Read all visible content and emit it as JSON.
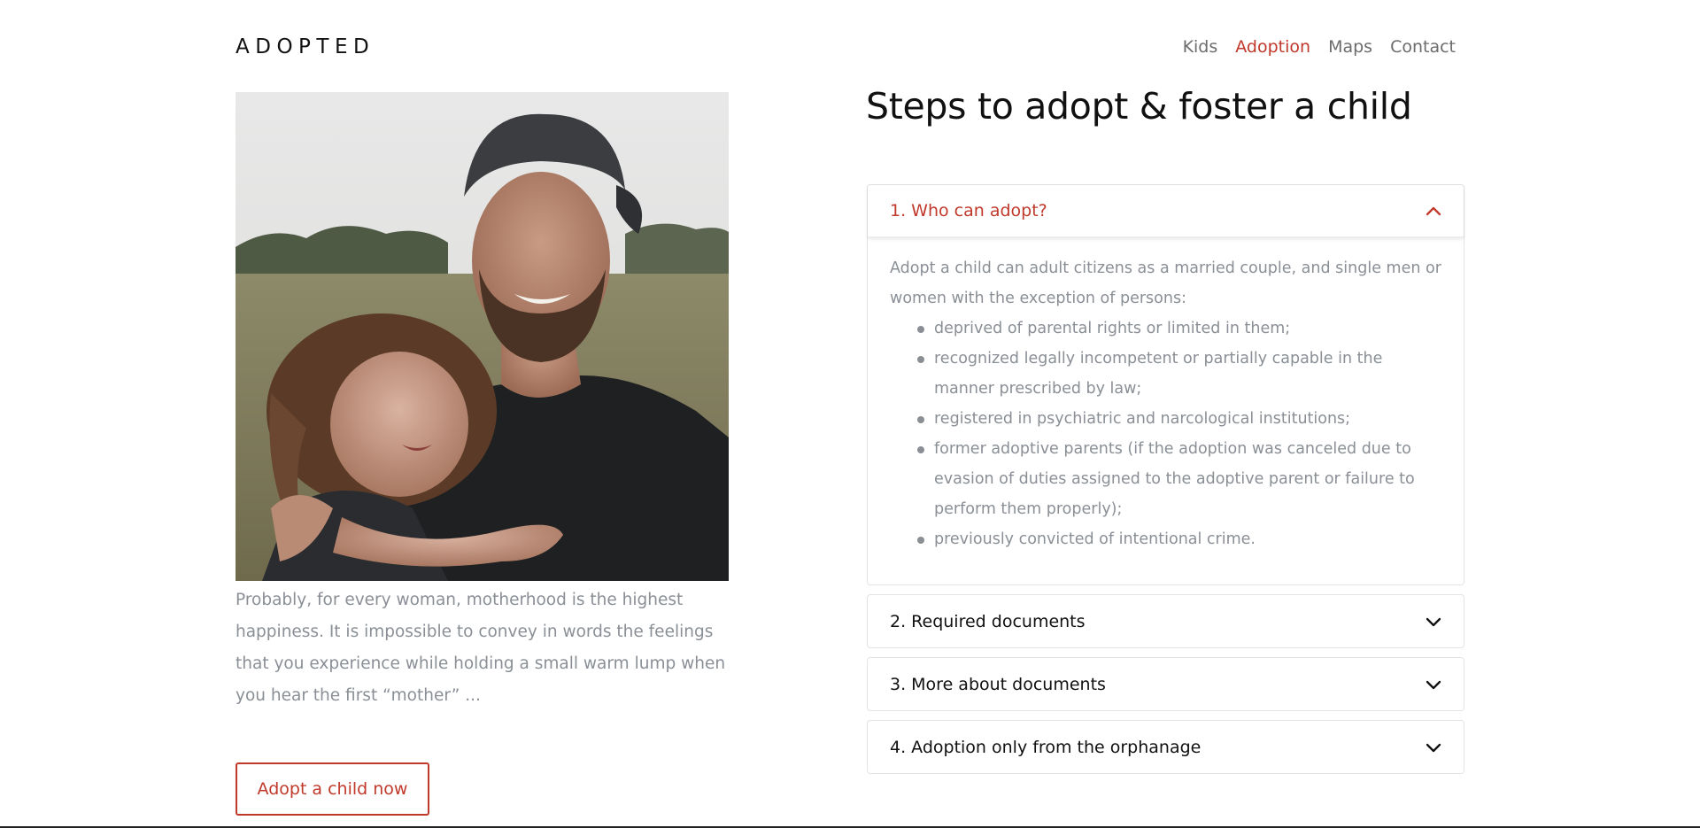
{
  "header": {
    "logo": "ADOPTED",
    "nav": [
      {
        "label": "Kids",
        "active": false
      },
      {
        "label": "Adoption",
        "active": true
      },
      {
        "label": "Maps",
        "active": false
      },
      {
        "label": "Contact",
        "active": false
      }
    ]
  },
  "hero": {
    "intro": "Probably, for every woman, motherhood is the highest happiness. It is impossible to convey in words the feelings that you experience while holding a small warm lump when you hear the first “mother” ...",
    "cta_label": "Adopt a child now"
  },
  "steps": {
    "title": "Steps to adopt & foster a child",
    "items": [
      {
        "label": "1. Who can adopt?",
        "open": true,
        "body_text": "Adopt a child can adult citizens as a married couple, and single men or women with the exception of persons:",
        "bullets": [
          "deprived of parental rights or limited in them;",
          "recognized legally incompetent or partially capable in the manner prescribed by law;",
          "registered in psychiatric and narcological institutions;",
          "former adoptive parents (if the adoption was canceled due to evasion of duties assigned to the adoptive parent or failure to perform them properly);",
          "previously convicted of intentional crime."
        ]
      },
      {
        "label": "2. Required documents",
        "open": false
      },
      {
        "label": "3. More about documents",
        "open": false
      },
      {
        "label": "4. Adoption only from the orphanage",
        "open": false
      }
    ]
  },
  "colors": {
    "accent": "#c0392b",
    "muted_text": "#8a8f96",
    "nav_text": "#6c6c6c",
    "border": "#e3e3e3"
  },
  "icons": {
    "open": "chevron-up-icon",
    "closed": "chevron-down-icon"
  }
}
